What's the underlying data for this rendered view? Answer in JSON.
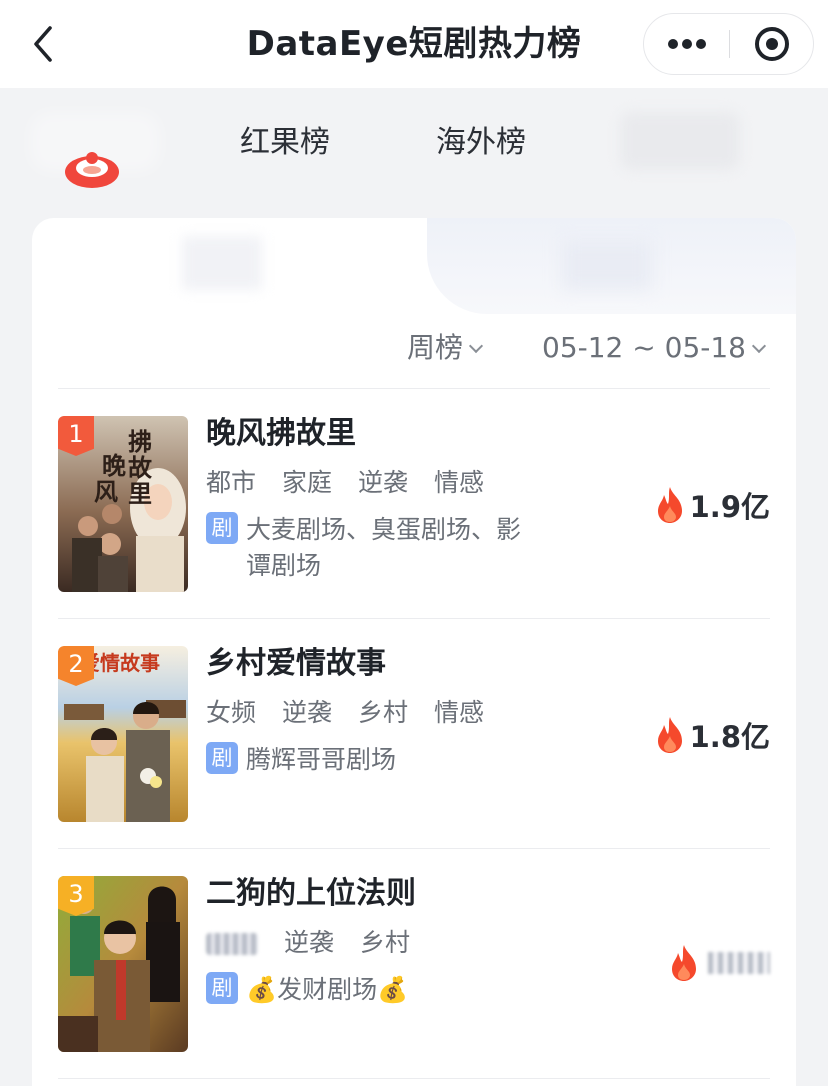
{
  "header": {
    "title": "DataEye短剧热力榜"
  },
  "tabs": [
    {
      "label": "红果榜"
    },
    {
      "label": "海外榜"
    }
  ],
  "filters": {
    "period": "周榜",
    "date_range": "05-12 ~ 05-18"
  },
  "rankings": [
    {
      "rank": "1",
      "title": "晚风拂故里",
      "tags": [
        "都市",
        "家庭",
        "逆袭",
        "情感"
      ],
      "platform_badge": "剧",
      "platform_line1": "大麦剧场、臭蛋剧场、影",
      "platform_line2": "谭剧场",
      "heat": "1.9亿",
      "badge_color": "#f25a3c"
    },
    {
      "rank": "2",
      "title": "乡村爱情故事",
      "tags": [
        "女频",
        "逆袭",
        "乡村",
        "情感"
      ],
      "platform_badge": "剧",
      "platform_line1": "腾辉哥哥剧场",
      "heat": "1.8亿",
      "badge_color": "#f5842c"
    },
    {
      "rank": "3",
      "title": "二狗的上位法则",
      "tags": [
        "逆袭",
        "乡村"
      ],
      "platform_badge": "剧",
      "platform_line1": "💰发财剧场💰",
      "badge_color": "#f6b025"
    }
  ],
  "icons": {
    "back": "chevron-left-icon",
    "menu": "more-dots-icon",
    "close": "record-circle-icon",
    "logo": "red-fruit-logo-icon",
    "heat": "flame-icon",
    "dropdown": "chevron-down-icon"
  },
  "colors": {
    "flame": "#f5492c",
    "badge_blue": "#7ea9f5"
  }
}
